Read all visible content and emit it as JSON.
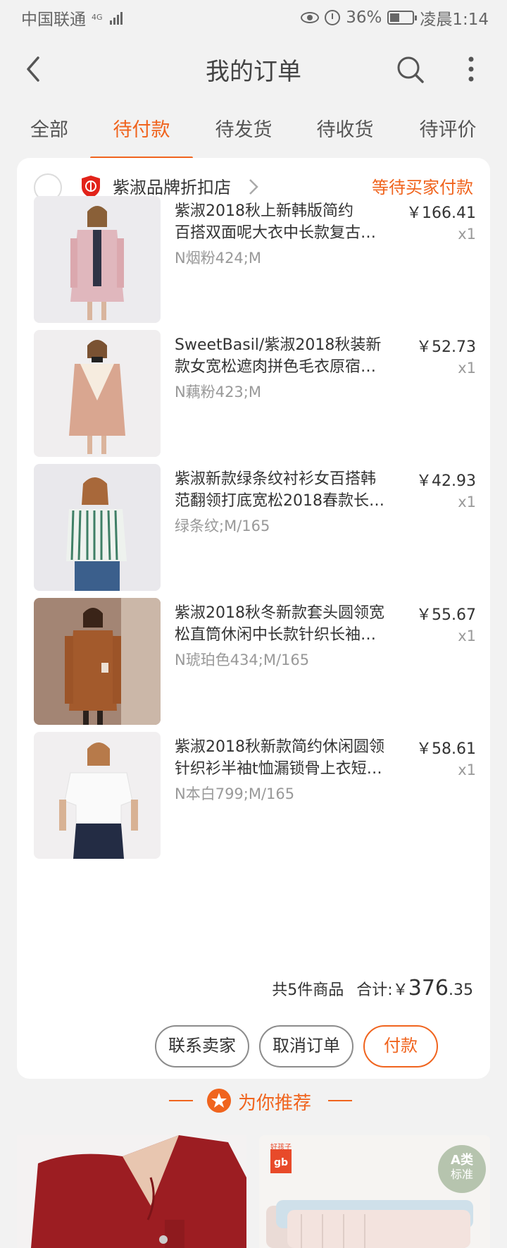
{
  "status_bar": {
    "carrier": "中国联通",
    "network": "4G",
    "battery": "36%",
    "time": "凌晨1:14"
  },
  "header": {
    "title": "我的订单"
  },
  "tabs": [
    {
      "label": "全部",
      "active": false
    },
    {
      "label": "待付款",
      "active": true
    },
    {
      "label": "待发货",
      "active": false
    },
    {
      "label": "待收货",
      "active": false
    },
    {
      "label": "待评价",
      "active": false
    }
  ],
  "order": {
    "shop_name": "紫淑品牌折扣店",
    "status": "等待买家付款",
    "items": [
      {
        "title_line1": "紫淑2018秋上新韩版简约",
        "title_line2": "百搭双面呢大衣中长款复古…",
        "variant": "N烟粉424;M",
        "price": "￥166.41",
        "qty": "x1"
      },
      {
        "title_line1": "SweetBasil/紫淑2018秋装新",
        "title_line2": "款女宽松遮肉拼色毛衣原宿…",
        "variant": "N藕粉423;M",
        "price": "￥52.73",
        "qty": "x1"
      },
      {
        "title_line1": "紫淑新款绿条纹衬衫女百搭韩",
        "title_line2": "范翻领打底宽松2018春款长…",
        "variant": "绿条纹;M/165",
        "price": "￥42.93",
        "qty": "x1"
      },
      {
        "title_line1": "紫淑2018秋冬新款套头圆领宽",
        "title_line2": "松直筒休闲中长款针织长袖…",
        "variant": "N琥珀色434;M/165",
        "price": "￥55.67",
        "qty": "x1"
      },
      {
        "title_line1": "紫淑2018秋新款简约休闲圆领",
        "title_line2": "针织衫半袖t恤漏锁骨上衣短…",
        "variant": "N本白799;M/165",
        "price": "￥58.61",
        "qty": "x1"
      }
    ],
    "summary_count": "共5件商品",
    "summary_label": "合计:",
    "summary_currency": "￥",
    "summary_int": "376",
    "summary_dec": ".35",
    "buttons": {
      "contact": "联系卖家",
      "cancel": "取消订单",
      "pay": "付款"
    }
  },
  "recommend": {
    "label": "为你推荐",
    "brand_logo": "gb",
    "brand_logo_top": "好孩子",
    "badge_top": "A类",
    "badge_bottom": "标准"
  },
  "colors": {
    "accent": "#f0641e",
    "background": "#f2f2f2"
  }
}
